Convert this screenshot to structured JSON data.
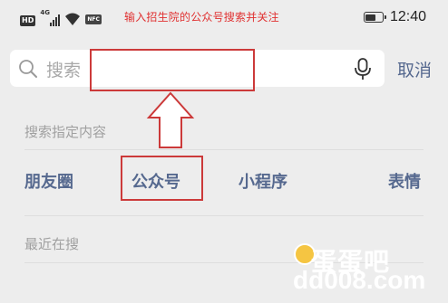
{
  "status_bar": {
    "hd_badge": "HD",
    "network": "4G",
    "nfc": "NFC",
    "time": "12:40",
    "battery_level": 0.7
  },
  "annotation_top": "输入招生院的公众号搜索并关注",
  "search": {
    "placeholder": "搜索",
    "cancel_label": "取消"
  },
  "section_specific": {
    "title": "搜索指定内容",
    "categories": [
      "朋友圈",
      "公众号",
      "小程序",
      "表情"
    ]
  },
  "section_recent": {
    "title": "最近在搜"
  },
  "watermark": {
    "brand": "蛋蛋吧",
    "url": "dd008.com"
  },
  "colors": {
    "accent": "#56698f",
    "annotation": "#cc3a3a",
    "background": "#ededed"
  }
}
